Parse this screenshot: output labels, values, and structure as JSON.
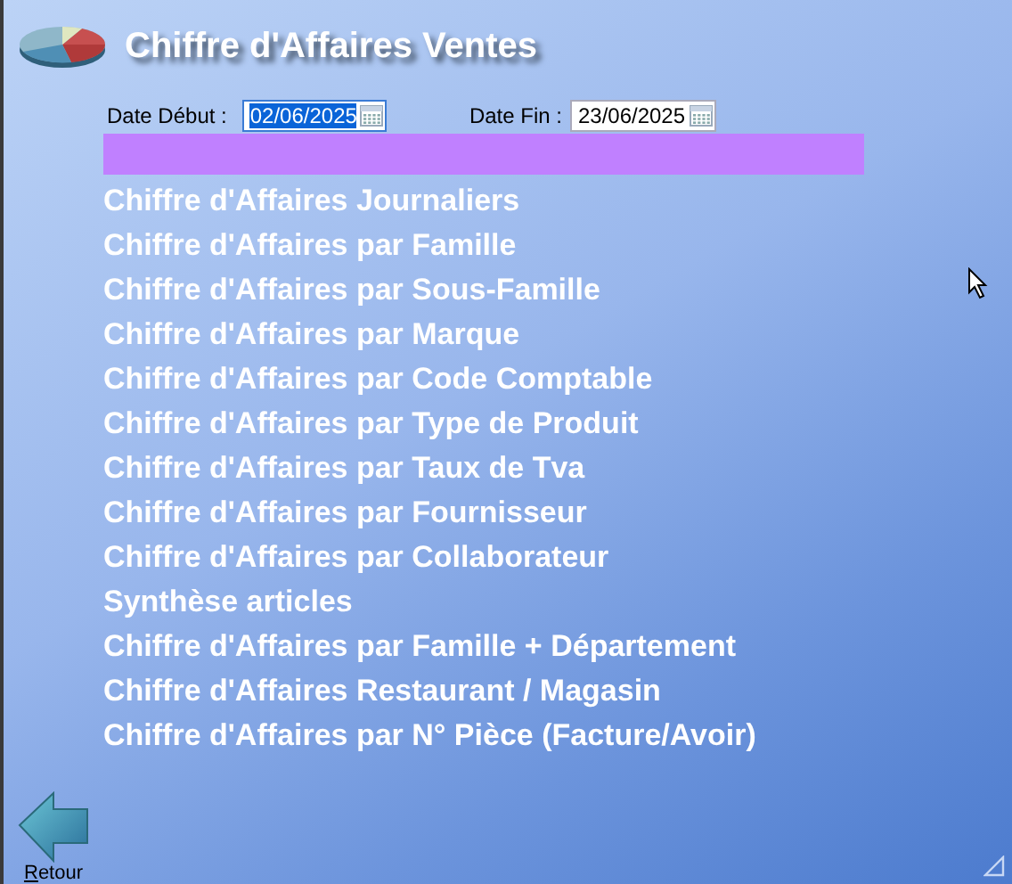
{
  "window": {
    "title": "Chiffre d'Affaires Ventes"
  },
  "dates": [
    {
      "label": "Date Début :",
      "value": "02/06/2025",
      "text_selected": true
    },
    {
      "label": "Date Fin :",
      "value": "23/06/2025",
      "text_selected": false
    }
  ],
  "reports": [
    "Chiffre d'Affaires Journaliers",
    "Chiffre d'Affaires par Famille",
    "Chiffre d'Affaires par Sous-Famille",
    "Chiffre d'Affaires par Marque",
    "Chiffre d'Affaires par Code Comptable",
    "Chiffre d'Affaires par Type de Produit",
    "Chiffre d'Affaires par Taux de Tva",
    "Chiffre d'Affaires par Fournisseur",
    "Chiffre d'Affaires par Collaborateur",
    "Synthèse articles",
    "Chiffre d'Affaires par Famille + Département",
    "Chiffre d'Affaires Restaurant / Magasin",
    "Chiffre d'Affaires par N° Pièce (Facture/Avoir)"
  ],
  "back_button": {
    "label": "Retour"
  }
}
